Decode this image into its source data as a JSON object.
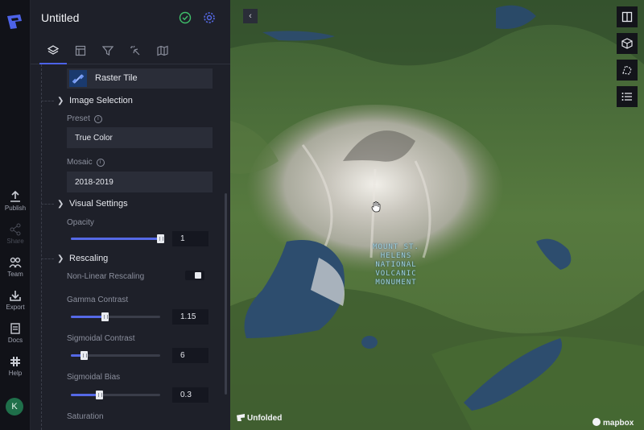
{
  "rail": {
    "items": [
      {
        "label": "Publish",
        "icon": "upload-icon",
        "enabled": true
      },
      {
        "label": "Share",
        "icon": "share-icon",
        "enabled": false
      },
      {
        "label": "Team",
        "icon": "team-icon",
        "enabled": true
      },
      {
        "label": "Export",
        "icon": "download-icon",
        "enabled": true
      },
      {
        "label": "Docs",
        "icon": "docs-icon",
        "enabled": true
      },
      {
        "label": "Help",
        "icon": "help-icon",
        "enabled": true
      }
    ],
    "avatar_initial": "K"
  },
  "panel": {
    "title": "Untitled",
    "tabs": [
      "layers-icon",
      "layout-icon",
      "filter-icon",
      "interactions-icon",
      "basemap-icon"
    ],
    "layer_card": {
      "label": "Raster Tile",
      "icon": "satellite-icon"
    },
    "image_selection": {
      "heading": "Image Selection",
      "preset_label": "Preset",
      "preset_value": "True Color",
      "mosaic_label": "Mosaic",
      "mosaic_value": "2018-2019"
    },
    "visual_settings": {
      "heading": "Visual Settings",
      "opacity_label": "Opacity",
      "opacity_value": "1",
      "opacity_fraction": 1.0
    },
    "rescaling": {
      "heading": "Rescaling",
      "nonlinear_label": "Non-Linear Rescaling",
      "nonlinear_on": true,
      "gamma_label": "Gamma Contrast",
      "gamma_value": "1.15",
      "gamma_fraction": 0.37,
      "sigmoidal_contrast_label": "Sigmoidal Contrast",
      "sigmoidal_contrast_value": "6",
      "sigmoidal_contrast_fraction": 0.12,
      "sigmoidal_bias_label": "Sigmoidal Bias",
      "sigmoidal_bias_value": "0.3",
      "sigmoidal_bias_fraction": 0.3,
      "saturation_label": "Saturation"
    }
  },
  "map": {
    "label_lines": [
      "MOUNT ST.",
      "HELENS",
      "NATIONAL",
      "VOLCANIC",
      "MONUMENT"
    ],
    "brand": "Unfolded",
    "basemap_brand": "mapbox",
    "tools": [
      "split-map-icon",
      "3d-cube-icon",
      "draw-polygon-icon",
      "legend-icon"
    ]
  },
  "colors": {
    "accent": "#5569e6",
    "panel_bg": "#1e2029",
    "rail_bg": "#111218"
  }
}
